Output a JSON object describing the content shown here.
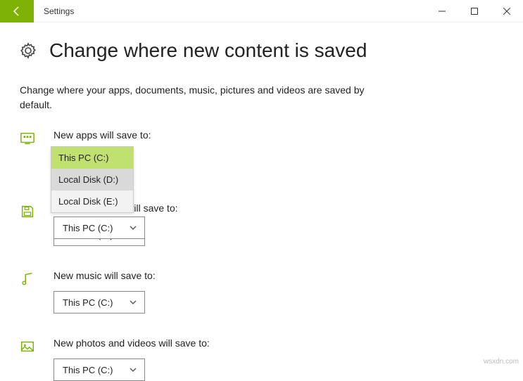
{
  "window": {
    "title": "Settings"
  },
  "page": {
    "heading": "Change where new content is saved",
    "description": "Change where your apps, documents, music, pictures and videos are saved by default."
  },
  "dropdown": {
    "options": [
      {
        "label": "This PC (C:)",
        "selected": true,
        "hover": false
      },
      {
        "label": "Local Disk (D:)",
        "selected": false,
        "hover": true
      },
      {
        "label": "Local Disk (E:)",
        "selected": false,
        "hover": false
      }
    ]
  },
  "settings": [
    {
      "label": "New apps will save to:",
      "value": "This PC (C:)",
      "dropdown_open": true
    },
    {
      "label": "New documents will save to:",
      "value": "This PC (C:)",
      "dropdown_open": false
    },
    {
      "label": "New music will save to:",
      "value": "This PC (C:)",
      "dropdown_open": false
    },
    {
      "label": "New photos and videos will save to:",
      "value": "This PC (C:)",
      "dropdown_open": false
    }
  ],
  "watermark": "wsxdn.com"
}
